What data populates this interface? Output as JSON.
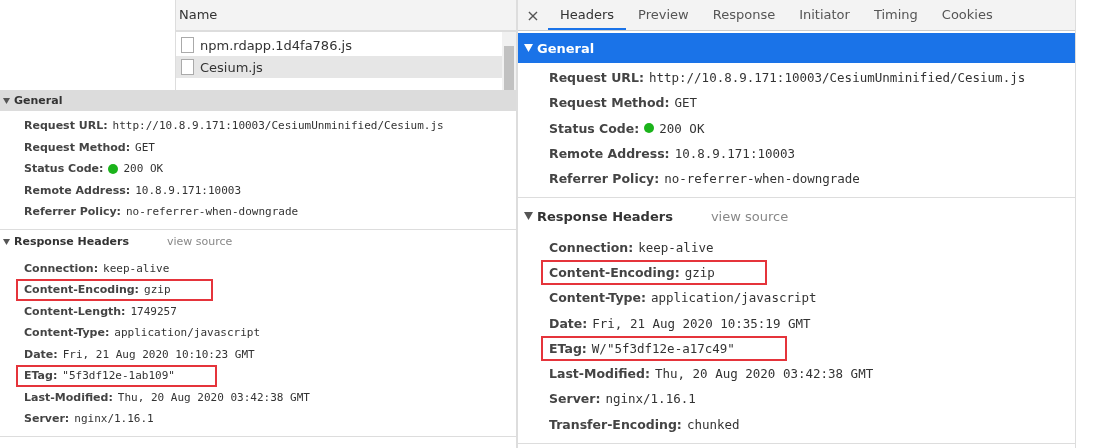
{
  "left": {
    "file_list": {
      "header": "Name",
      "files": [
        {
          "name": "npm.rdapp.1d4fa786.js",
          "selected": false
        },
        {
          "name": "Cesium.js",
          "selected": true
        }
      ]
    },
    "sections": [
      {
        "title": "General",
        "selected": false,
        "rows": [
          {
            "label": "Request URL:",
            "value": "http://10.8.9.171:10003/CesiumUnminified/Cesium.js",
            "kind": "plain",
            "highlighted": false
          },
          {
            "label": "Request Method:",
            "value": "GET",
            "kind": "plain",
            "highlighted": false
          },
          {
            "label": "Status Code:",
            "value": "200 OK",
            "kind": "status",
            "highlighted": false
          },
          {
            "label": "Remote Address:",
            "value": "10.8.9.171:10003",
            "kind": "plain",
            "highlighted": false
          },
          {
            "label": "Referrer Policy:",
            "value": "no-referrer-when-downgrade",
            "kind": "plain",
            "highlighted": false
          }
        ]
      },
      {
        "title": "Response Headers",
        "link": "view source",
        "selected": false,
        "rows": [
          {
            "label": "Connection:",
            "value": "keep-alive",
            "kind": "plain",
            "highlighted": false
          },
          {
            "label": "Content-Encoding:",
            "value": "gzip",
            "kind": "plain",
            "highlighted": true
          },
          {
            "label": "Content-Length:",
            "value": "1749257",
            "kind": "plain",
            "highlighted": false
          },
          {
            "label": "Content-Type:",
            "value": "application/javascript",
            "kind": "plain",
            "highlighted": false
          },
          {
            "label": "Date:",
            "value": "Fri, 21 Aug 2020 10:10:23 GMT",
            "kind": "plain",
            "highlighted": false
          },
          {
            "label": "ETag:",
            "value": "\"5f3df12e-1ab109\"",
            "kind": "plain",
            "highlighted": true
          },
          {
            "label": "Last-Modified:",
            "value": "Thu, 20 Aug 2020 03:42:38 GMT",
            "kind": "plain",
            "highlighted": false
          },
          {
            "label": "Server:",
            "value": "nginx/1.16.1",
            "kind": "plain",
            "highlighted": false
          }
        ]
      }
    ]
  },
  "right": {
    "close": "×",
    "tabs": [
      {
        "label": "Headers",
        "selected": true
      },
      {
        "label": "Preview",
        "selected": false
      },
      {
        "label": "Response",
        "selected": false
      },
      {
        "label": "Initiator",
        "selected": false
      },
      {
        "label": "Timing",
        "selected": false
      },
      {
        "label": "Cookies",
        "selected": false
      }
    ],
    "sections": [
      {
        "title": "General",
        "selected": true,
        "rows": [
          {
            "label": "Request URL:",
            "value": "http://10.8.9.171:10003/CesiumUnminified/Cesium.js",
            "kind": "plain",
            "highlighted": false
          },
          {
            "label": "Request Method:",
            "value": "GET",
            "kind": "plain",
            "highlighted": false
          },
          {
            "label": "Status Code:",
            "value": "200 OK",
            "kind": "status",
            "highlighted": false
          },
          {
            "label": "Remote Address:",
            "value": "10.8.9.171:10003",
            "kind": "plain",
            "highlighted": false
          },
          {
            "label": "Referrer Policy:",
            "value": "no-referrer-when-downgrade",
            "kind": "plain",
            "highlighted": false
          }
        ]
      },
      {
        "title": "Response Headers",
        "link": "view source",
        "selected": false,
        "rows": [
          {
            "label": "Connection:",
            "value": "keep-alive",
            "kind": "plain",
            "highlighted": false
          },
          {
            "label": "Content-Encoding:",
            "value": "gzip",
            "kind": "plain",
            "highlighted": true
          },
          {
            "label": "Content-Type:",
            "value": "application/javascript",
            "kind": "plain",
            "highlighted": false
          },
          {
            "label": "Date:",
            "value": "Fri, 21 Aug 2020 10:35:19 GMT",
            "kind": "plain",
            "highlighted": false
          },
          {
            "label": "ETag:",
            "value": "W/\"5f3df12e-a17c49\"",
            "kind": "plain",
            "highlighted": true
          },
          {
            "label": "Last-Modified:",
            "value": "Thu, 20 Aug 2020 03:42:38 GMT",
            "kind": "plain",
            "highlighted": false
          },
          {
            "label": "Server:",
            "value": "nginx/1.16.1",
            "kind": "plain",
            "highlighted": false
          },
          {
            "label": "Transfer-Encoding:",
            "value": "chunked",
            "kind": "plain",
            "highlighted": false
          }
        ]
      }
    ]
  }
}
